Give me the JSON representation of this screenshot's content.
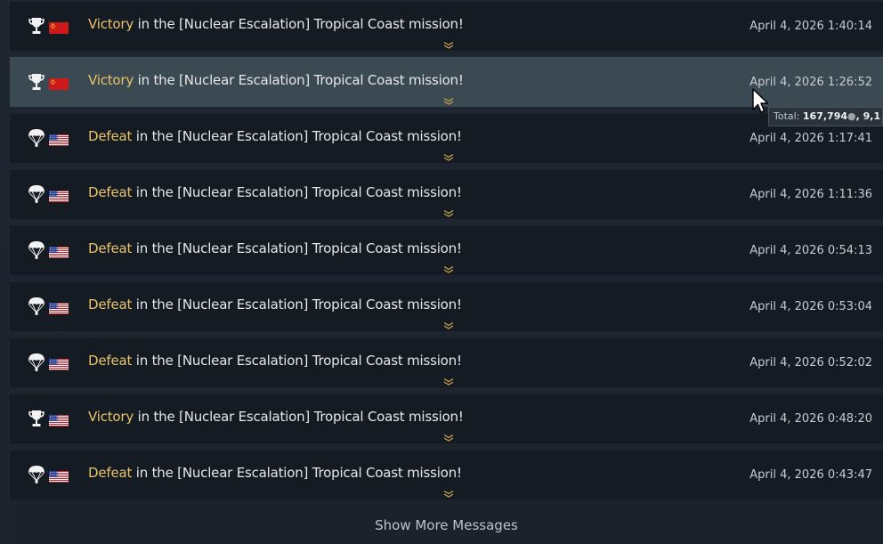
{
  "messages": [
    {
      "result_word": "Victory",
      "rest": " in the [Nuclear Escalation] Tropical Coast mission!",
      "timestamp": "April 4, 2026 1:40:14",
      "result_icon": "trophy-icon",
      "nation": "ussr",
      "flag_icon": "ussr-flag-icon"
    },
    {
      "result_word": "Victory",
      "rest": " in the [Nuclear Escalation] Tropical Coast mission!",
      "timestamp": "April 4, 2026 1:26:52",
      "result_icon": "trophy-icon",
      "nation": "ussr",
      "flag_icon": "ussr-flag-icon"
    },
    {
      "result_word": "Defeat",
      "rest": " in the [Nuclear Escalation] Tropical Coast mission!",
      "timestamp": "April 4, 2026 1:17:41",
      "result_icon": "parachute-icon",
      "nation": "usa",
      "flag_icon": "usa-flag-icon"
    },
    {
      "result_word": "Defeat",
      "rest": " in the [Nuclear Escalation] Tropical Coast mission!",
      "timestamp": "April 4, 2026 1:11:36",
      "result_icon": "parachute-icon",
      "nation": "usa",
      "flag_icon": "usa-flag-icon"
    },
    {
      "result_word": "Defeat",
      "rest": " in the [Nuclear Escalation] Tropical Coast mission!",
      "timestamp": "April 4, 2026 0:54:13",
      "result_icon": "parachute-icon",
      "nation": "usa",
      "flag_icon": "usa-flag-icon"
    },
    {
      "result_word": "Defeat",
      "rest": " in the [Nuclear Escalation] Tropical Coast mission!",
      "timestamp": "April 4, 2026 0:53:04",
      "result_icon": "parachute-icon",
      "nation": "usa",
      "flag_icon": "usa-flag-icon"
    },
    {
      "result_word": "Defeat",
      "rest": " in the [Nuclear Escalation] Tropical Coast mission!",
      "timestamp": "April 4, 2026 0:52:02",
      "result_icon": "parachute-icon",
      "nation": "usa",
      "flag_icon": "usa-flag-icon"
    },
    {
      "result_word": "Victory",
      "rest": " in the [Nuclear Escalation] Tropical Coast mission!",
      "timestamp": "April 4, 2026 0:48:20",
      "result_icon": "trophy-icon",
      "nation": "usa",
      "flag_icon": "usa-flag-icon"
    },
    {
      "result_word": "Defeat",
      "rest": " in the [Nuclear Escalation] Tropical Coast mission!",
      "timestamp": "April 4, 2026 0:43:47",
      "result_icon": "parachute-icon",
      "nation": "usa",
      "flag_icon": "usa-flag-icon"
    }
  ],
  "hovered_index": 1,
  "tooltip": {
    "label": "Total:",
    "value": "167,794",
    "currency_icon": "silver-lions-icon",
    "extra": ", 9,1"
  },
  "show_more_label": "Show More Messages",
  "colors": {
    "result_word": "#e8c36a",
    "row_bg": "#151b23",
    "row_hover_bg": "#3b4952",
    "text": "#e6e8ea"
  }
}
